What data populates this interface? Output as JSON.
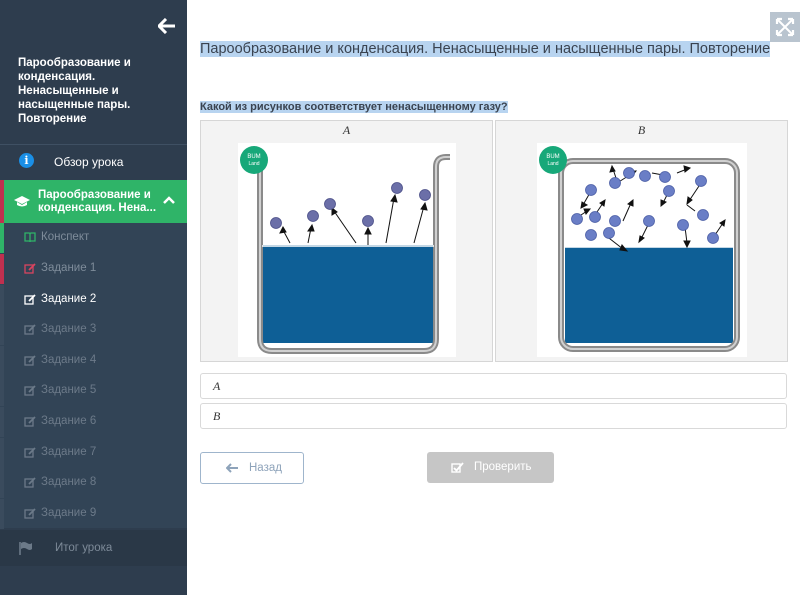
{
  "sidebar": {
    "course_title": "Парообразование и конденсация. Ненасыщенные и насыщенные пары. Повторение",
    "overview_label": "Обзор урока",
    "active_topic_label": "Парообразование и конденсация. Нена...",
    "items": [
      {
        "label": "Конспект",
        "icon": "book-icon",
        "status": "done"
      },
      {
        "label": "Задание 1",
        "icon": "edit-icon",
        "status": "wrong"
      },
      {
        "label": "Задание 2",
        "icon": "edit-icon",
        "status": "current"
      },
      {
        "label": "Задание 3",
        "icon": "edit-icon",
        "status": "locked"
      },
      {
        "label": "Задание 4",
        "icon": "edit-icon",
        "status": "locked"
      },
      {
        "label": "Задание 5",
        "icon": "edit-icon",
        "status": "locked"
      },
      {
        "label": "Задание 6",
        "icon": "edit-icon",
        "status": "locked"
      },
      {
        "label": "Задание 7",
        "icon": "edit-icon",
        "status": "locked"
      },
      {
        "label": "Задание 8",
        "icon": "edit-icon",
        "status": "locked"
      },
      {
        "label": "Задание 9",
        "icon": "edit-icon",
        "status": "locked"
      }
    ],
    "finish_label": "Итог урока"
  },
  "main": {
    "title": "Парообразование и конденсация. Ненасыщенные и насыщенные пары. Повторение",
    "question": "Какой из рисунков соответствует ненасыщенному газу?",
    "figures": [
      {
        "caption": "A",
        "logo": "BUM Land"
      },
      {
        "caption": "B",
        "logo": "BUM Land"
      }
    ],
    "answers": [
      {
        "label": "A"
      },
      {
        "label": "B"
      }
    ],
    "back_label": "Назад",
    "check_label": "Проверить"
  },
  "colors": {
    "sidebar_bg": "#2e3d4e",
    "accent_green": "#2fb468",
    "wrong_red": "#c0304f",
    "water_blue": "#0e5f96",
    "molecule": "#6b6fa8",
    "logo_green": "#17a879"
  }
}
